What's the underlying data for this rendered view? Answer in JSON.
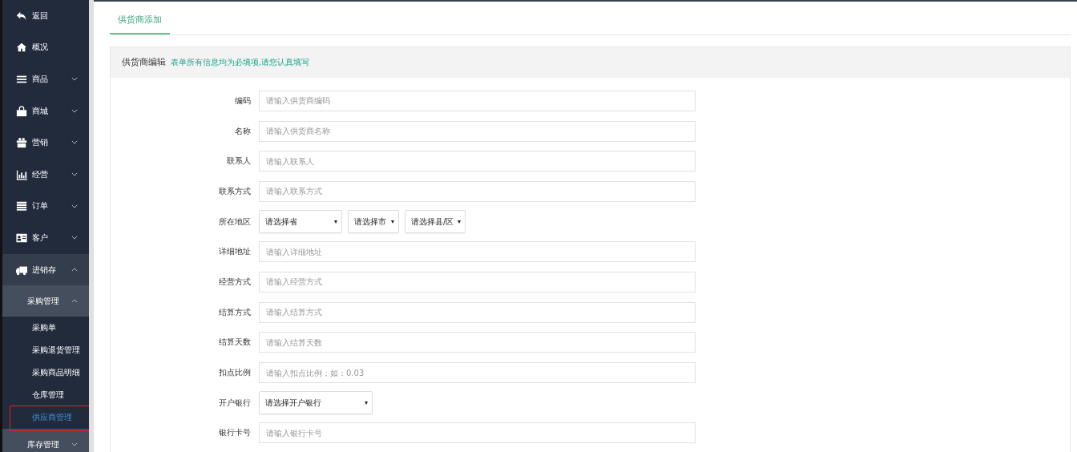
{
  "sidebar": {
    "items": [
      {
        "label": "返回"
      },
      {
        "label": "概况"
      },
      {
        "label": "商品",
        "expanded": false
      },
      {
        "label": "商城",
        "expanded": false
      },
      {
        "label": "营销",
        "expanded": false
      },
      {
        "label": "经营",
        "expanded": false
      },
      {
        "label": "订单",
        "expanded": false
      },
      {
        "label": "客户",
        "expanded": false
      },
      {
        "label": "进销存",
        "expanded": true,
        "children": [
          {
            "label": "采购管理",
            "expanded": true,
            "children": [
              {
                "label": "采购单",
                "selected": false,
                "highlighted": false
              },
              {
                "label": "采购退货管理",
                "selected": false,
                "highlighted": false
              },
              {
                "label": "采购商品明细",
                "selected": false,
                "highlighted": false
              },
              {
                "label": "仓库管理",
                "selected": false,
                "highlighted": false
              },
              {
                "label": "供应商管理",
                "selected": true,
                "highlighted": true
              }
            ]
          },
          {
            "label": "库存管理",
            "expanded": false
          }
        ]
      }
    ]
  },
  "tabs": [
    {
      "label": "供货商添加",
      "selected": true
    }
  ],
  "panel": {
    "title": "供货商编辑",
    "note": "表单所有信息均为必填项,请您认真填写"
  },
  "form": [
    {
      "kind": "input",
      "label": "编码",
      "placeholder": "请输入供货商编码"
    },
    {
      "kind": "input",
      "label": "名称",
      "placeholder": "请输入供货商名称"
    },
    {
      "kind": "input",
      "label": "联系人",
      "placeholder": "请输入联系人"
    },
    {
      "kind": "input",
      "label": "联系方式",
      "placeholder": "请输入联系方式"
    },
    {
      "kind": "region",
      "label": "所在地区",
      "selects": [
        "请选择省",
        "请选择市",
        "请选择县/区"
      ]
    },
    {
      "kind": "input",
      "label": "详细地址",
      "placeholder": "请输入详细地址"
    },
    {
      "kind": "input",
      "label": "经营方式",
      "placeholder": "请输入经营方式"
    },
    {
      "kind": "input",
      "label": "结算方式",
      "placeholder": "请输入结算方式"
    },
    {
      "kind": "input",
      "label": "结算天数",
      "placeholder": "请输入结算天数"
    },
    {
      "kind": "input",
      "label": "扣点比例",
      "placeholder": "请输入扣点比例；如：0.03"
    },
    {
      "kind": "select",
      "label": "开户银行",
      "value": "请选择开户银行"
    },
    {
      "kind": "input",
      "label": "银行卡号",
      "placeholder": "请输入银行卡号"
    }
  ]
}
